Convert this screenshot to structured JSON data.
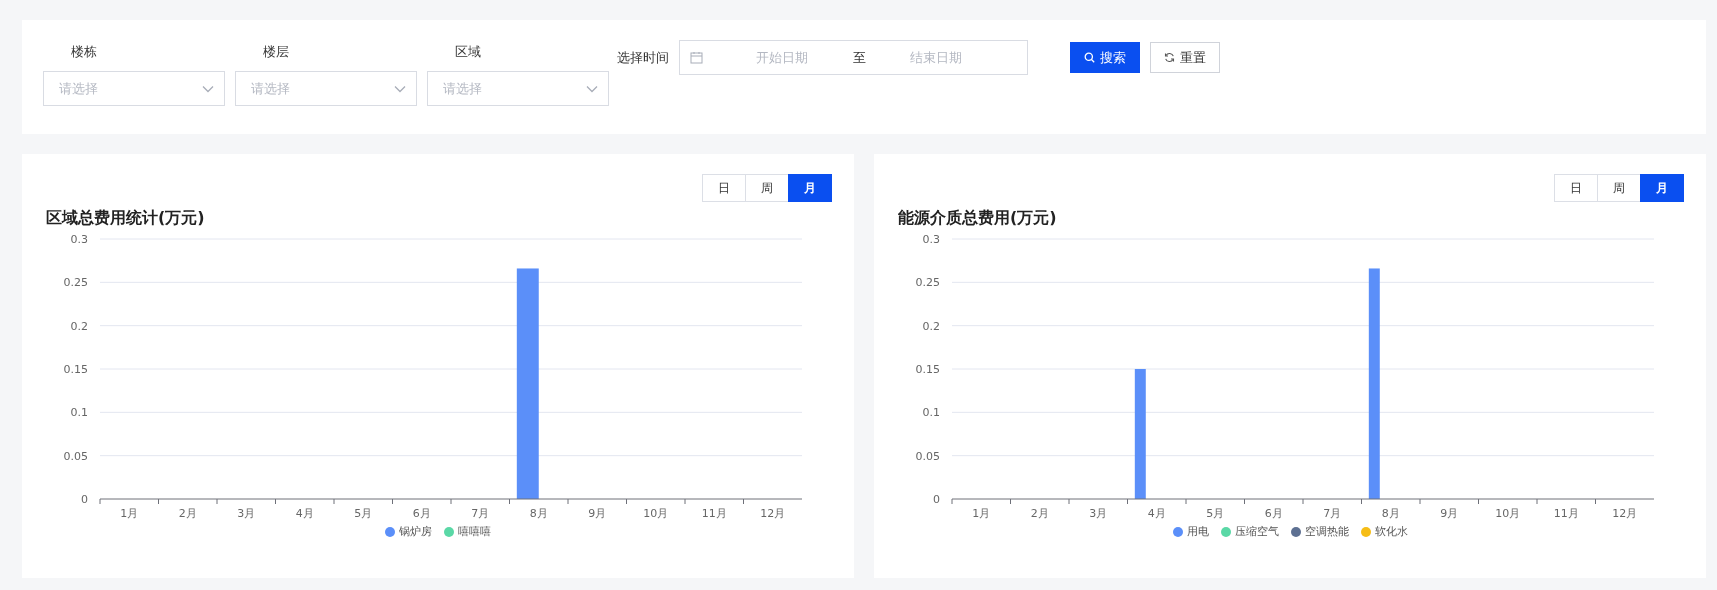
{
  "filters": [
    {
      "label": "楼栋",
      "placeholder": "请选择"
    },
    {
      "label": "楼层",
      "placeholder": "请选择"
    },
    {
      "label": "区域",
      "placeholder": "请选择"
    }
  ],
  "time_range": {
    "label": "选择时间",
    "start_placeholder": "开始日期",
    "separator": "至",
    "end_placeholder": "结束日期"
  },
  "buttons": [
    {
      "label": "搜索",
      "kind": "primary"
    },
    {
      "label": "重置",
      "kind": "default"
    }
  ],
  "charts": [
    {
      "title": "区域总费用统计(万元)",
      "periods": [
        {
          "label": "日",
          "selected": false
        },
        {
          "label": "周",
          "selected": false
        },
        {
          "label": "月",
          "selected": true
        }
      ],
      "chart_data": {
        "type": "bar",
        "grid": true,
        "categories": [
          "1月",
          "2月",
          "3月",
          "4月",
          "5月",
          "6月",
          "7月",
          "8月",
          "9月",
          "10月",
          "11月",
          "12月"
        ],
        "ylim": [
          0,
          0.3
        ],
        "yticks": [
          0,
          0.05,
          0.1,
          0.15,
          0.2,
          0.25,
          0.3
        ],
        "series": [
          {
            "name": "锅炉房",
            "color": "#5b8ff9",
            "values": [
              0,
              0,
              0,
              0,
              0,
              0,
              0,
              0.266,
              0,
              0,
              0,
              0
            ]
          },
          {
            "name": "嘻嘻嘻",
            "color": "#5ad8a6",
            "values": [
              0,
              0,
              0,
              0,
              0,
              0,
              0,
              0,
              0,
              0,
              0,
              0
            ]
          }
        ]
      }
    },
    {
      "title": "能源介质总费用(万元)",
      "periods": [
        {
          "label": "日",
          "selected": false
        },
        {
          "label": "周",
          "selected": false
        },
        {
          "label": "月",
          "selected": true
        }
      ],
      "chart_data": {
        "type": "bar",
        "grid": true,
        "categories": [
          "1月",
          "2月",
          "3月",
          "4月",
          "5月",
          "6月",
          "7月",
          "8月",
          "9月",
          "10月",
          "11月",
          "12月"
        ],
        "ylim": [
          0,
          0.3
        ],
        "yticks": [
          0,
          0.05,
          0.1,
          0.15,
          0.2,
          0.25,
          0.3
        ],
        "series": [
          {
            "name": "用电",
            "color": "#5b8ff9",
            "values": [
              0,
              0,
              0,
              0.15,
              0,
              0,
              0,
              0.266,
              0,
              0,
              0,
              0
            ]
          },
          {
            "name": "压缩空气",
            "color": "#5ad8a6",
            "values": [
              0,
              0,
              0,
              0,
              0,
              0,
              0,
              0,
              0,
              0,
              0,
              0
            ]
          },
          {
            "name": "空调热能",
            "color": "#5d7092",
            "values": [
              0,
              0,
              0,
              0,
              0,
              0,
              0,
              0,
              0,
              0,
              0,
              0
            ]
          },
          {
            "name": "软化水",
            "color": "#f6bd16",
            "values": [
              0,
              0,
              0,
              0,
              0,
              0,
              0,
              0,
              0,
              0,
              0,
              0
            ]
          }
        ]
      }
    }
  ]
}
